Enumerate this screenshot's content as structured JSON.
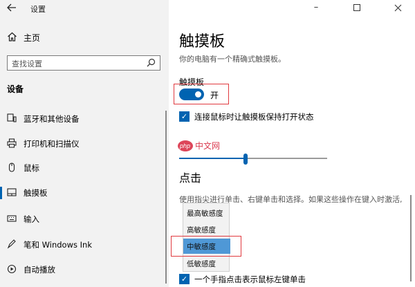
{
  "window": {
    "title": "设置"
  },
  "sidebar": {
    "home_label": "主页",
    "search_placeholder": "查找设置",
    "section_title": "设备",
    "items": [
      {
        "label": "蓝牙和其他设备",
        "icon": "devices-icon"
      },
      {
        "label": "打印机和扫描仪",
        "icon": "printer-icon"
      },
      {
        "label": "鼠标",
        "icon": "mouse-icon"
      },
      {
        "label": "触摸板",
        "icon": "touchpad-icon",
        "active": true
      },
      {
        "label": "输入",
        "icon": "keyboard-icon"
      },
      {
        "label": "笔和 Windows Ink",
        "icon": "pen-icon"
      },
      {
        "label": "自动播放",
        "icon": "autoplay-icon"
      }
    ]
  },
  "main": {
    "title": "触摸板",
    "description": "你的电脑有一个精确式触摸板。",
    "touchpad_label": "触摸板",
    "toggle_state": "开",
    "toggle_on": true,
    "checkbox_mouse_label": "连接鼠标时让触摸板保持打开状态",
    "checkbox_mouse_checked": true,
    "watermark_text": "php中文网",
    "cursor_speed_fraction": 0.45,
    "click_section_title": "点击",
    "click_description": "使用指尖进行单击、右键单击和选择。如果这些操作在键入时激活,",
    "sensitivity_options": [
      "最高敏感度",
      "高敏感度",
      "中敏感度",
      "低敏感度"
    ],
    "sensitivity_selected": "中敏感度",
    "checkbox_single_tap_label": "一个手指点击表示鼠标左键单击",
    "checkbox_single_tap_checked": true
  },
  "colors": {
    "accent": "#0063b1",
    "highlight_box": "#e0393e",
    "selected_option": "#4f98d6"
  }
}
